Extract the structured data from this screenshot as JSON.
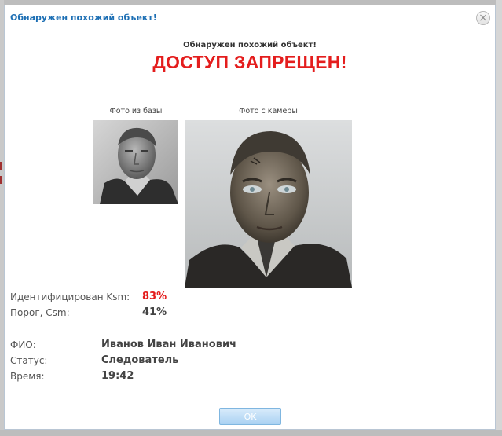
{
  "dialog": {
    "title": "Обнаружен похожий объект!",
    "close_symbol": "×",
    "subtitle": "Обнаружен похожий объект!",
    "access_message": "ДОСТУП ЗАПРЕЩЕН!"
  },
  "photos": {
    "db_caption": "Фото из базы",
    "camera_caption": "Фото с камеры"
  },
  "match": {
    "ksm_label": "Идентифицирован Ksm:",
    "ksm_value": "83%",
    "csm_label": "Порог, Csm:",
    "csm_value": "41%"
  },
  "person": {
    "name_label": "ФИО:",
    "name_value": "Иванов Иван Иванович",
    "status_label": "Статус:",
    "status_value": "Следователь",
    "time_label": "Время:",
    "time_value": "19:42"
  },
  "footer": {
    "ok_label": "OK"
  },
  "colors": {
    "title_blue": "#1d6fb4",
    "alert_red": "#e41d1d",
    "ok_button": "#a9d1f2"
  }
}
